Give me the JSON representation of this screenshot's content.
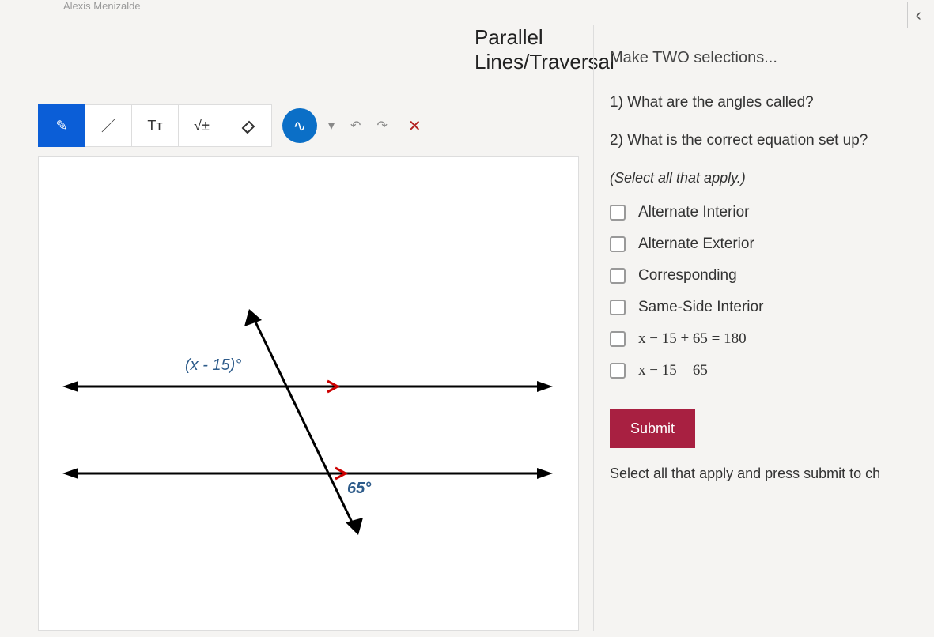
{
  "header": {
    "student_name": "Alexis Menizalde"
  },
  "toolbar": {
    "pen": "✎",
    "line": "／",
    "text": "Tᴛ",
    "math": "√±",
    "eraser": "⌫",
    "scribble": "∿",
    "dropdown": "▾",
    "undo": "↶",
    "redo": "↷",
    "close": "✕"
  },
  "diagram": {
    "label_top": "(x - 15)°",
    "label_bottom": "65°"
  },
  "question": {
    "title": "Parallel Lines/Traversal",
    "subtitle": "Make TWO selections...",
    "q1": "1) What are the angles called?",
    "q2": "2) What is the correct equation set up?",
    "hint": "(Select all that apply.)",
    "options": [
      "Alternate Interior",
      "Alternate Exterior",
      "Corresponding",
      "Same-Side Interior",
      "x − 15 + 65 = 180",
      "x − 15 = 65"
    ],
    "submit": "Submit",
    "footer": "Select all that apply and press submit to ch"
  },
  "nav": {
    "prev": "‹"
  }
}
